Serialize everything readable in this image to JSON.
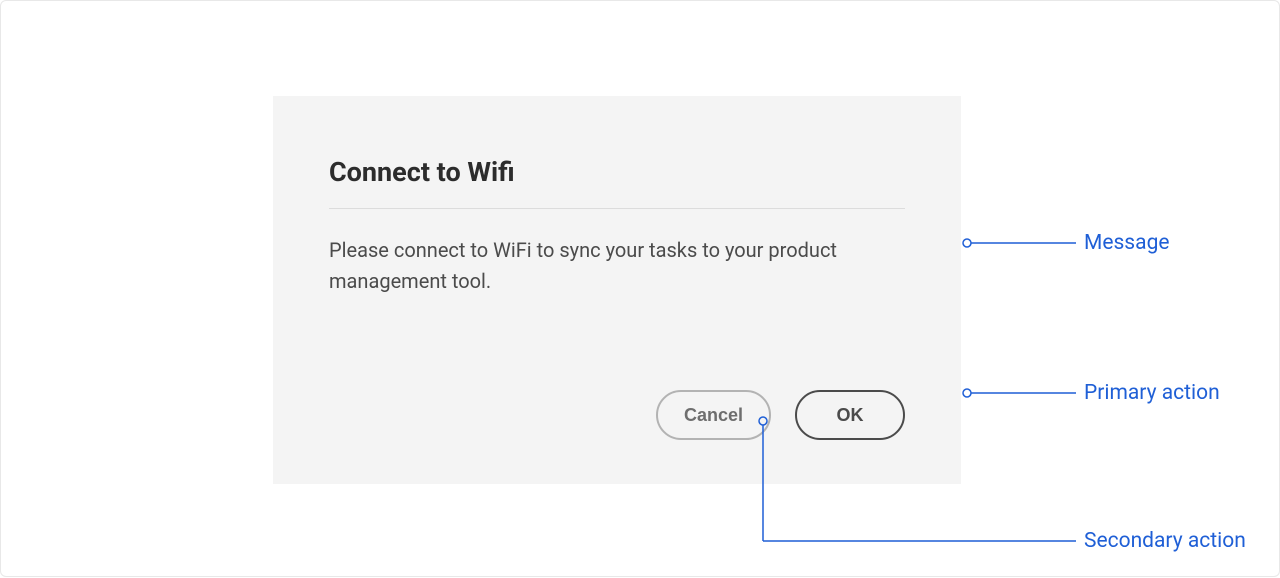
{
  "dialog": {
    "title": "Connect to Wifi",
    "message": "Please connect to WiFi to sync your tasks to your product management tool.",
    "secondary_label": "Cancel",
    "primary_label": "OK"
  },
  "annotations": {
    "message": "Message",
    "primary": "Primary action",
    "secondary": "Secondary action"
  },
  "colors": {
    "annotation": "#1f5fd6",
    "dialog_bg": "#f4f4f4"
  }
}
